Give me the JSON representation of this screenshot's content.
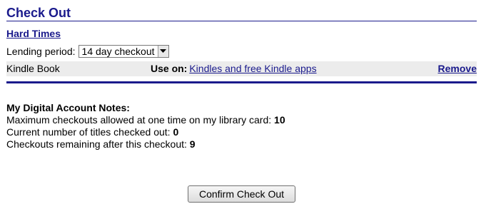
{
  "header": {
    "title": "Check Out"
  },
  "item": {
    "book_title": "Hard Times",
    "lending_label": "Lending period:",
    "lending_selected": "14 day checkout",
    "format": "Kindle Book",
    "use_on_label": "Use on:",
    "use_on_link": "Kindles and free Kindle apps",
    "remove_label": "Remove"
  },
  "notes": {
    "heading": "My Digital Account Notes:",
    "max_label": "Maximum checkouts allowed at one time on my library card:",
    "max_value": "10",
    "current_label": "Current number of titles checked out:",
    "current_value": "0",
    "remaining_label": "Checkouts remaining after this checkout:",
    "remaining_value": "9"
  },
  "actions": {
    "confirm_label": "Confirm Check Out"
  },
  "colors": {
    "accent": "#1a1a8c",
    "row_background": "#ececec"
  },
  "icons": {
    "dropdown": "chevron-down-icon"
  }
}
